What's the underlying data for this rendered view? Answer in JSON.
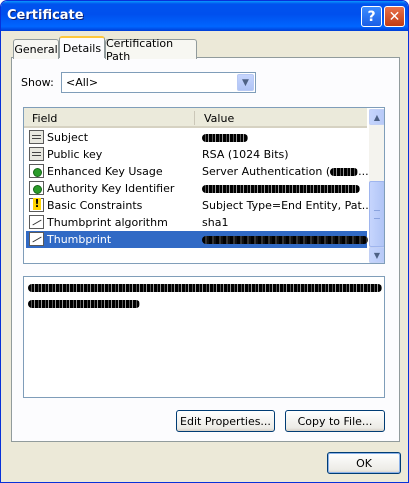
{
  "window": {
    "title": "Certificate",
    "help_label": "?",
    "close_label": "✕"
  },
  "tabs": [
    {
      "label": "General"
    },
    {
      "label": "Details"
    },
    {
      "label": "Certification Path"
    }
  ],
  "show": {
    "label": "Show:",
    "selected": "<All>"
  },
  "list": {
    "columns": {
      "field": "Field",
      "value": "Value"
    },
    "rows": [
      {
        "field": "Subject",
        "value": "",
        "icon": "certificate-field-icon",
        "redacted": true
      },
      {
        "field": "Public key",
        "value": "RSA (1024 Bits)",
        "icon": "certificate-field-icon",
        "redacted": false
      },
      {
        "field": "Enhanced Key Usage",
        "value": "Server Authentication (",
        "icon": "extension-icon",
        "redacted_suffix": "....",
        "redacted": false
      },
      {
        "field": "Authority Key Identifier",
        "value": "",
        "icon": "extension-icon",
        "redacted": true
      },
      {
        "field": "Basic Constraints",
        "value": "Subject Type=End Entity, Pat...",
        "icon": "critical-extension-icon",
        "redacted": false
      },
      {
        "field": "Thumbprint algorithm",
        "value": "sha1",
        "icon": "signature-icon",
        "redacted": false
      },
      {
        "field": "Thumbprint",
        "value": "",
        "icon": "signature-icon",
        "redacted": true,
        "selected": true
      }
    ]
  },
  "buttons": {
    "edit_properties": "Edit Properties...",
    "copy_to_file": "Copy to File...",
    "ok": "OK"
  },
  "colors": {
    "titlebar": "#0053ee",
    "selection": "#316ac5",
    "dialog_bg": "#ece9d8"
  }
}
